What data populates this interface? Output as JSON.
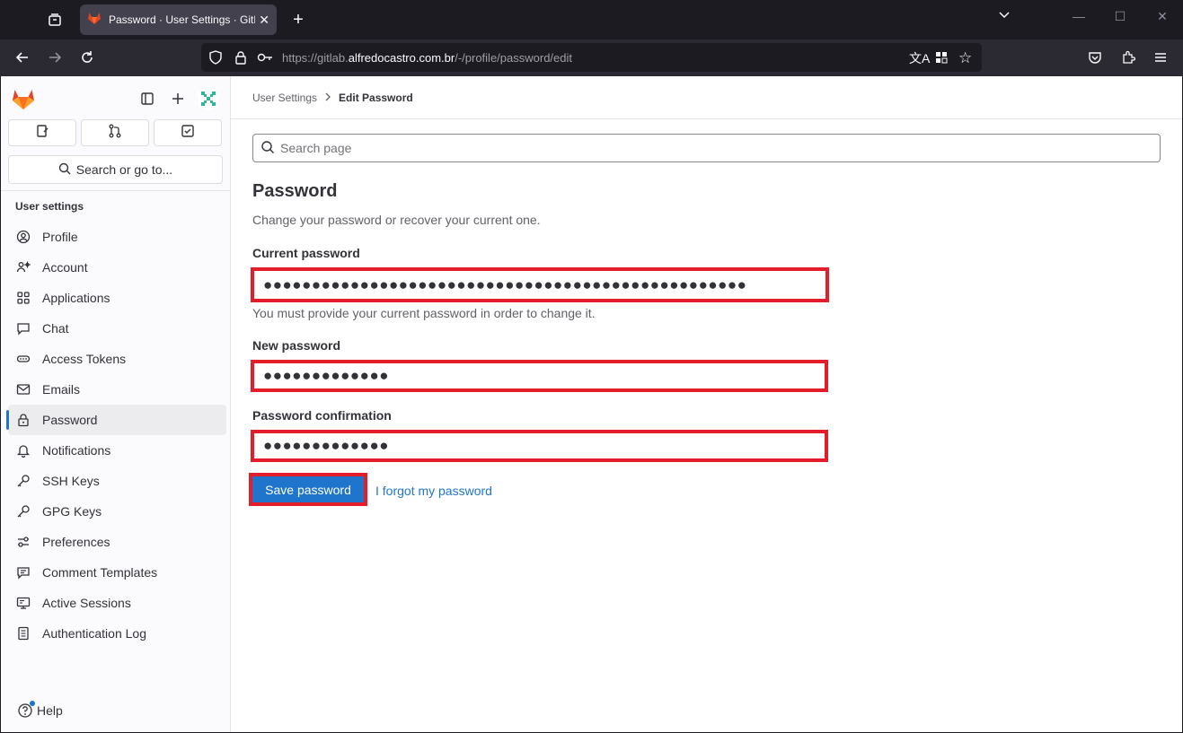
{
  "browser": {
    "tab_title": "Password · User Settings · GitLab",
    "tab_close": "✕",
    "url_prefix": "https://gitlab.",
    "url_host": "alfredocastro.com.br",
    "url_path": "/-/profile/password/edit"
  },
  "sidebar": {
    "search_label": "Search or go to...",
    "section_title": "User settings",
    "items": [
      {
        "label": "Profile",
        "icon": "profile-icon"
      },
      {
        "label": "Account",
        "icon": "account-icon"
      },
      {
        "label": "Applications",
        "icon": "applications-icon"
      },
      {
        "label": "Chat",
        "icon": "chat-icon"
      },
      {
        "label": "Access Tokens",
        "icon": "token-icon"
      },
      {
        "label": "Emails",
        "icon": "mail-icon"
      },
      {
        "label": "Password",
        "icon": "lock-icon"
      },
      {
        "label": "Notifications",
        "icon": "bell-icon"
      },
      {
        "label": "SSH Keys",
        "icon": "key-icon"
      },
      {
        "label": "GPG Keys",
        "icon": "key-icon"
      },
      {
        "label": "Preferences",
        "icon": "preferences-icon"
      },
      {
        "label": "Comment Templates",
        "icon": "comment-icon"
      },
      {
        "label": "Active Sessions",
        "icon": "monitor-icon"
      },
      {
        "label": "Authentication Log",
        "icon": "log-icon"
      }
    ],
    "active_item": "Password",
    "help_label": "Help"
  },
  "main": {
    "breadcrumb": {
      "parent": "User Settings",
      "current": "Edit Password"
    },
    "search_placeholder": "Search page",
    "title": "Password",
    "subtitle": "Change your password or recover your current one.",
    "current_password": {
      "label": "Current password",
      "value": "●●●●●●●●●●●●●●●●●●●●●●●●●●●●●●●●●●●●●●●●●●●●●●●●●●",
      "help": "You must provide your current password in order to change it."
    },
    "new_password": {
      "label": "New password",
      "value": "●●●●●●●●●●●●●"
    },
    "password_confirmation": {
      "label": "Password confirmation",
      "value": "●●●●●●●●●●●●●"
    },
    "save_label": "Save password",
    "forgot_label": "I forgot my password"
  },
  "colors": {
    "accent": "#1f75cb",
    "highlight": "#e41d2b"
  }
}
